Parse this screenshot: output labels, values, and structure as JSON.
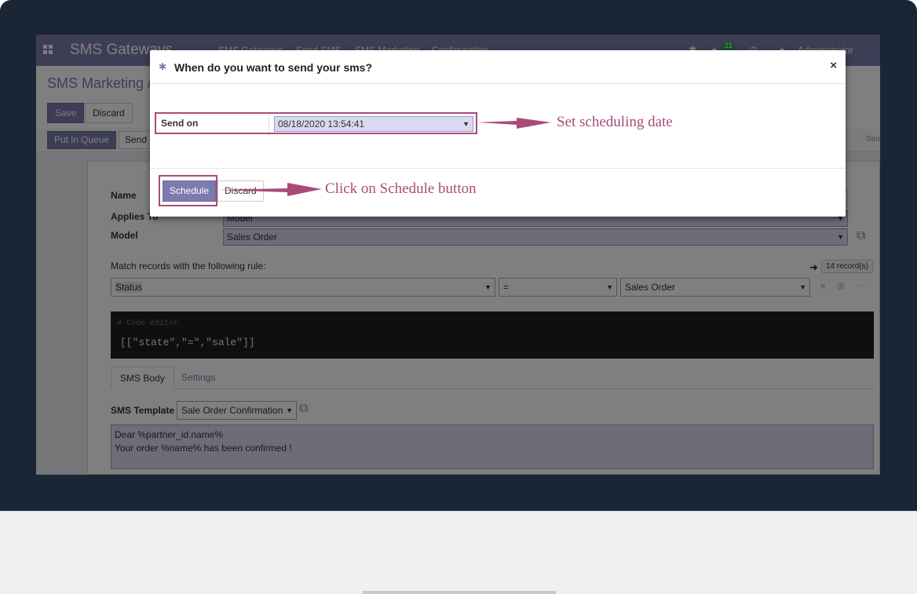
{
  "app": {
    "brand": "SMS Gateways",
    "menus": [
      "SMS Gateways",
      "Send SMS",
      "SMS Marketing",
      "Configuration"
    ],
    "notif_count": "21",
    "user": "Administrator (sms_"
  },
  "control_panel": {
    "breadcrumb": "SMS Marketing / S",
    "save_label": "Save",
    "discard_label": "Discard",
    "queue_label": "Put in Queue",
    "send_label": "Send I",
    "stage_label": "Sen"
  },
  "form": {
    "name_label": "Name",
    "applies_label": "Applies To",
    "applies_value": "Model",
    "model_label": "Model",
    "model_value": "Sales Order",
    "match_label": "Match records with the following rule:",
    "record_count": "14 record(s)",
    "rule_field": "Status",
    "rule_operator": "=",
    "rule_value": "Sales Order",
    "code_comment": "# Code editor",
    "code_text": "[[\"state\",\"=\",\"sale\"]]",
    "tabs": [
      "SMS Body",
      "Settings"
    ],
    "template_label": "SMS Template",
    "template_value": "Sale Order Confirmation",
    "body_line1": "Dear %partner_id.name%",
    "body_line2": "Your order %name% has been confirmed !"
  },
  "modal": {
    "title": "When do you want to send your sms?",
    "send_on_label": "Send on",
    "send_on_value": "08/18/2020 13:54:41",
    "schedule_label": "Schedule",
    "discard_label": "Discard"
  },
  "annotations": {
    "date_note": "Set scheduling date",
    "button_note": "Click on Schedule button"
  },
  "colors": {
    "accent": "#7c7bad",
    "callout": "#a94b7a",
    "frame": "#1a2636"
  },
  "icons": {
    "apps": "apps-grid-icon",
    "bug": "bug-icon",
    "close": "close-icon",
    "external": "external-link-icon",
    "arrow": "arrow-right-icon"
  }
}
